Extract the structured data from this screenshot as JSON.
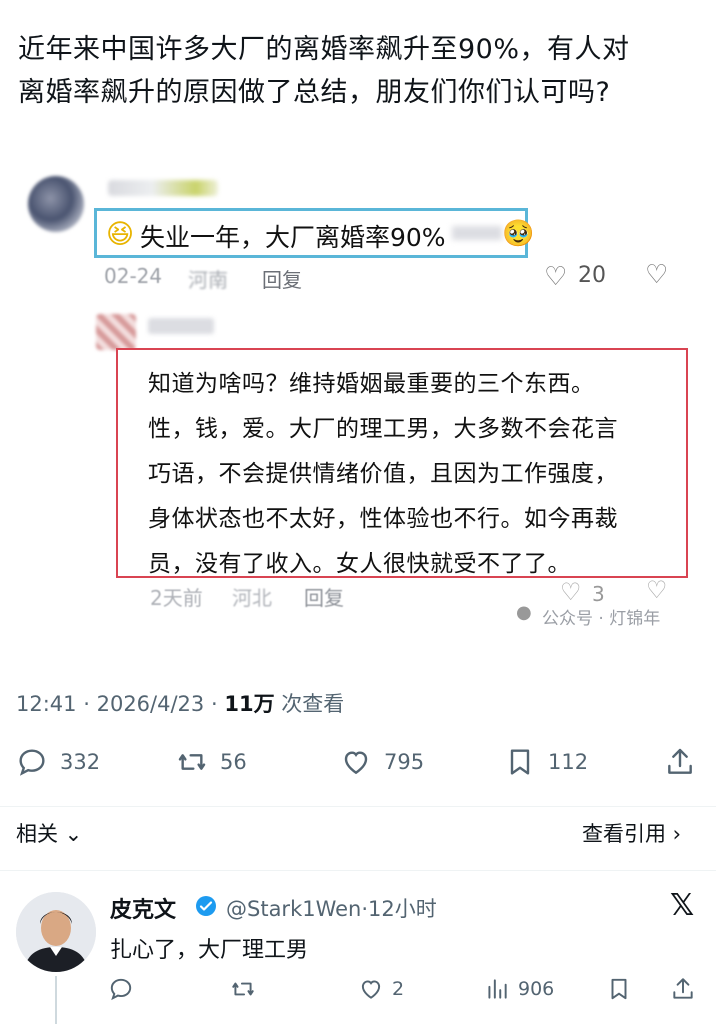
{
  "post": {
    "text_line1": "近年来中国许多大厂的离婚率飙升至90%，有人对",
    "text_line2": "离婚率飙升的原因做了总结，朋友们你们认可吗?"
  },
  "embedded": {
    "comment1": {
      "text": "失业一年，大厂离婚率90%",
      "date": "02-24",
      "location": "河南",
      "reply_label": "回复",
      "likes": "20"
    },
    "comment2": {
      "lines": [
        "知道为啥吗？维持婚姻最重要的三个东西。",
        "性，钱，爱。大厂的理工男，大多数不会花言",
        "巧语，不会提供情绪价值，且因为工作强度，",
        "身体状态也不太好，性体验也不行。如今再裁",
        "员，没有了收入。女人很快就受不了了。"
      ],
      "date": "2天前",
      "location": "河北",
      "reply_label": "回复",
      "likes": "3"
    },
    "watermark": "公众号 · 灯锦年"
  },
  "meta": {
    "time": "12:41",
    "date": "2026/4/23",
    "views": "11万",
    "views_label": "次查看"
  },
  "actions": {
    "replies": "332",
    "retweets": "56",
    "likes": "795",
    "bookmarks": "112"
  },
  "nav": {
    "related": "相关",
    "quotes": "查看引用"
  },
  "reply_tweet": {
    "name": "皮克文",
    "handle": "@Stark1Wen",
    "time": "12小时",
    "text": "扎心了，大厂理工男",
    "likes": "2",
    "views": "906"
  },
  "colors": {
    "comment1_border": "#5ab6d8",
    "comment2_border": "#d94452",
    "verified_blue": "#1d9bf0"
  },
  "icons": [
    "reply-icon",
    "retweet-icon",
    "heart-icon",
    "bookmark-icon",
    "share-icon",
    "views-icon",
    "verified-icon",
    "x-logo-icon",
    "chevron-down-icon",
    "chevron-right-icon"
  ]
}
